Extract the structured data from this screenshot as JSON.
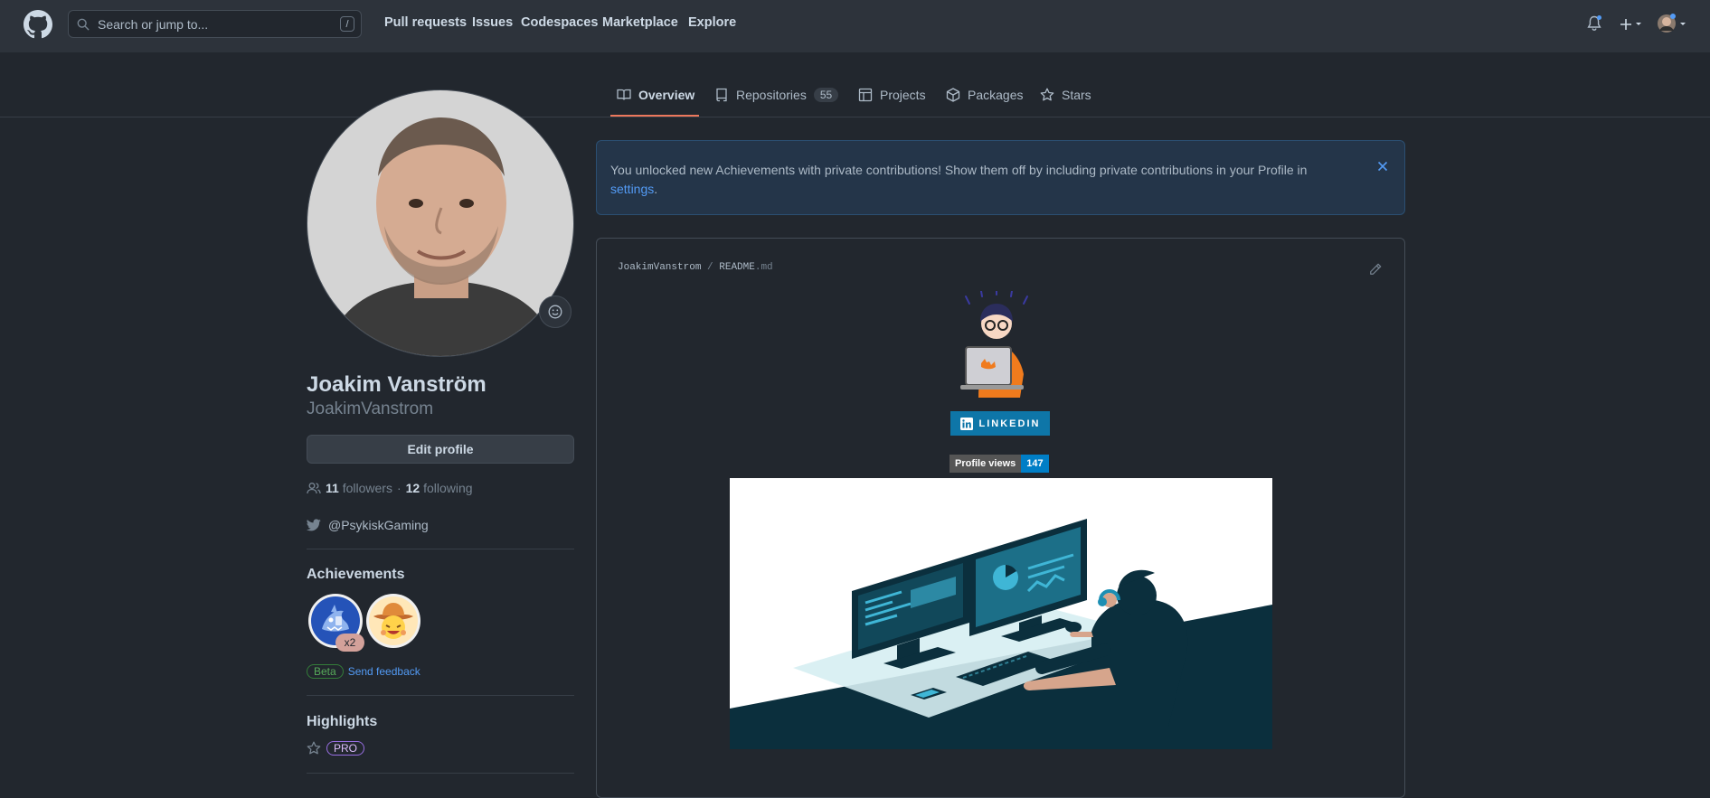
{
  "header": {
    "search_placeholder": "Search or jump to...",
    "search_key": "/",
    "nav": [
      "Pull requests",
      "Issues",
      "Codespaces",
      "Marketplace",
      "Explore"
    ]
  },
  "tabs": [
    {
      "label": "Overview",
      "selected": true
    },
    {
      "label": "Repositories",
      "count": "55"
    },
    {
      "label": "Projects"
    },
    {
      "label": "Packages"
    },
    {
      "label": "Stars"
    }
  ],
  "profile": {
    "name": "Joakim Vanström",
    "login": "JoakimVanstrom",
    "edit_button": "Edit profile",
    "followers_count": "11",
    "followers_label": "followers",
    "separator": "·",
    "following_count": "12",
    "following_label": "following",
    "twitter": "@PsykiskGaming"
  },
  "achievements": {
    "title": "Achievements",
    "multiplier": "x2",
    "beta_label": "Beta",
    "feedback_label": "Send feedback"
  },
  "highlights": {
    "title": "Highlights",
    "pro_label": "PRO"
  },
  "flash": {
    "message": "You unlocked new Achievements with private contributions! Show them off by including private contributions in your Profile in",
    "link": "settings",
    "end": "."
  },
  "readme": {
    "owner": "JoakimVanstrom",
    "slash": "/",
    "file": "README",
    "ext": ".md",
    "linkedin": "LINKEDIN",
    "views_label": "Profile views",
    "views_count": "147"
  },
  "colors": {
    "background": "#22272e",
    "header": "#2d333b",
    "accent_link": "#539bf5",
    "tab_underline": "#ec775c",
    "linkedin": "#0e76a8"
  }
}
